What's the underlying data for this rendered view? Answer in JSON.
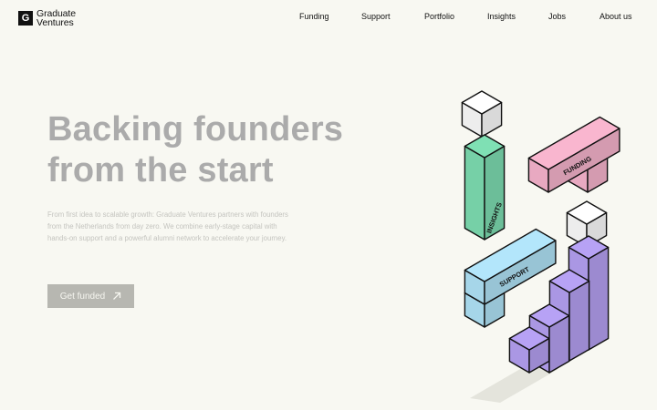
{
  "brand": {
    "logo_mark": "G",
    "line1": "Graduate",
    "line2": "Ventures"
  },
  "nav": [
    {
      "label": "Funding"
    },
    {
      "label": "Support"
    },
    {
      "label": "Portfolio"
    },
    {
      "label": "Insights"
    },
    {
      "label": "Jobs"
    },
    {
      "label": "About us"
    }
  ],
  "hero": {
    "title_line1": "Backing founders",
    "title_line2": "from the start",
    "description": "From first idea to scalable growth: Graduate Ventures partners with founders from the Netherlands from day zero. We combine early-stage capital with hands-on support and a powerful alumni network to accelerate your journey.",
    "cta_label": "Get funded",
    "cta_icon": "arrow-up-right-icon"
  },
  "illustration": {
    "block_labels": {
      "insights": "INSIGHTS",
      "funding": "FUNDING",
      "support": "SUPPORT"
    },
    "colors": {
      "insights": "#7fe0b4",
      "funding": "#f9b6cf",
      "support": "#b3e6fb",
      "stairs": "#b7a2f5",
      "plain": "#ffffff",
      "outline": "#111111",
      "background": "#f8f8f2",
      "title": "#ababab"
    }
  }
}
